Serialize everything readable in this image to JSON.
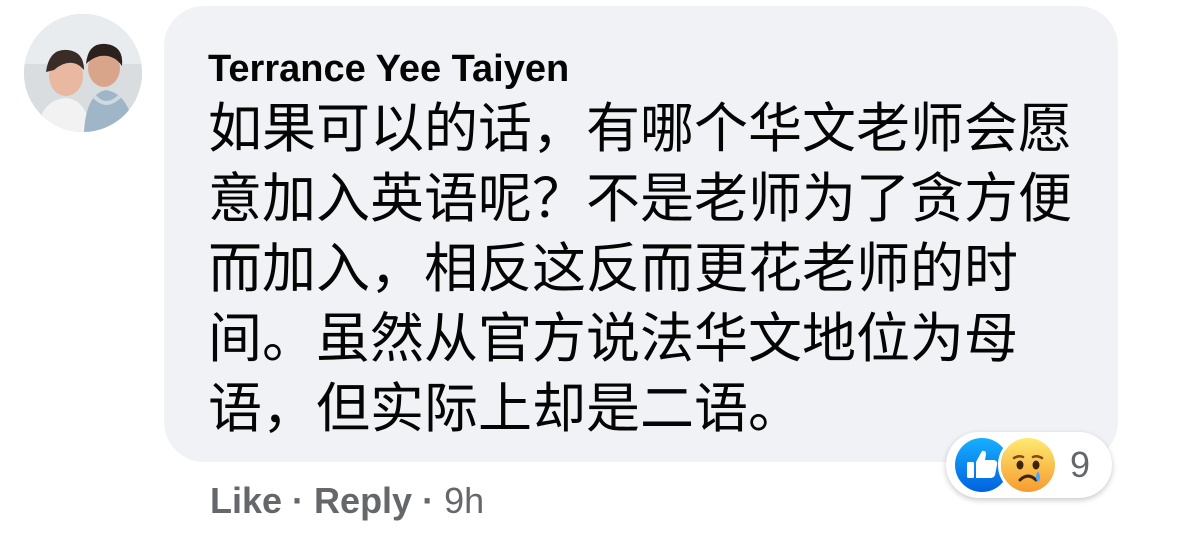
{
  "comment": {
    "author": "Terrance Yee Taiyen",
    "text": "如果可以的话，有哪个华文老师会愿意加入英语呢？不是老师为了贪方便而加入，相反这反而更花老师的时间。虽然从官方说法华文地位为母语，但实际上却是二语。",
    "reactions": {
      "icons": [
        "like-icon",
        "sad-icon"
      ],
      "count": "9"
    },
    "actions": {
      "like_label": "Like",
      "separator": "·",
      "reply_label": "Reply",
      "time": "9h"
    }
  },
  "colors": {
    "bubble_bg": "#f0f2f5",
    "text": "#050505",
    "secondary_text": "#65676b",
    "like_blue": "#1877f2",
    "sad_yellow": "#f7b125"
  }
}
